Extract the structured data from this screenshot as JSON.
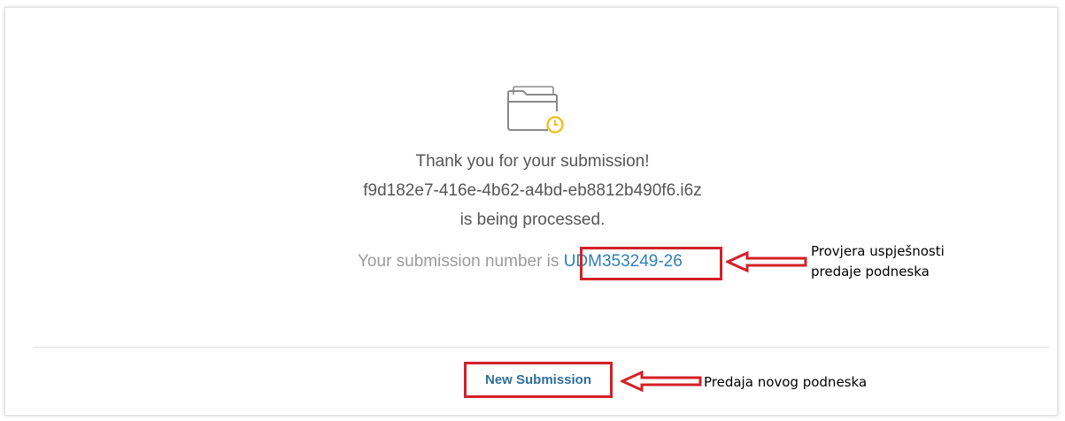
{
  "confirmation": {
    "thank_you": "Thank you for your submission!",
    "file_id": "f9d182e7-416e-4b62-a4bd-eb8812b490f6.i6z",
    "status": "is being processed.",
    "number_prefix": "Your submission number is ",
    "submission_number": "UDM353249-26",
    "icon": "folder-clock-icon"
  },
  "actions": {
    "new_submission_label": "New Submission"
  },
  "annotations": {
    "check_line1": "Provjera uspješnosti",
    "check_line2": "predaje podneska",
    "new_label": "Predaja novog podneska",
    "arrow_icon": "arrow-left-icon"
  },
  "colors": {
    "highlight": "#d42027",
    "link": "#2f7fb3",
    "clock": "#f2c12e"
  }
}
